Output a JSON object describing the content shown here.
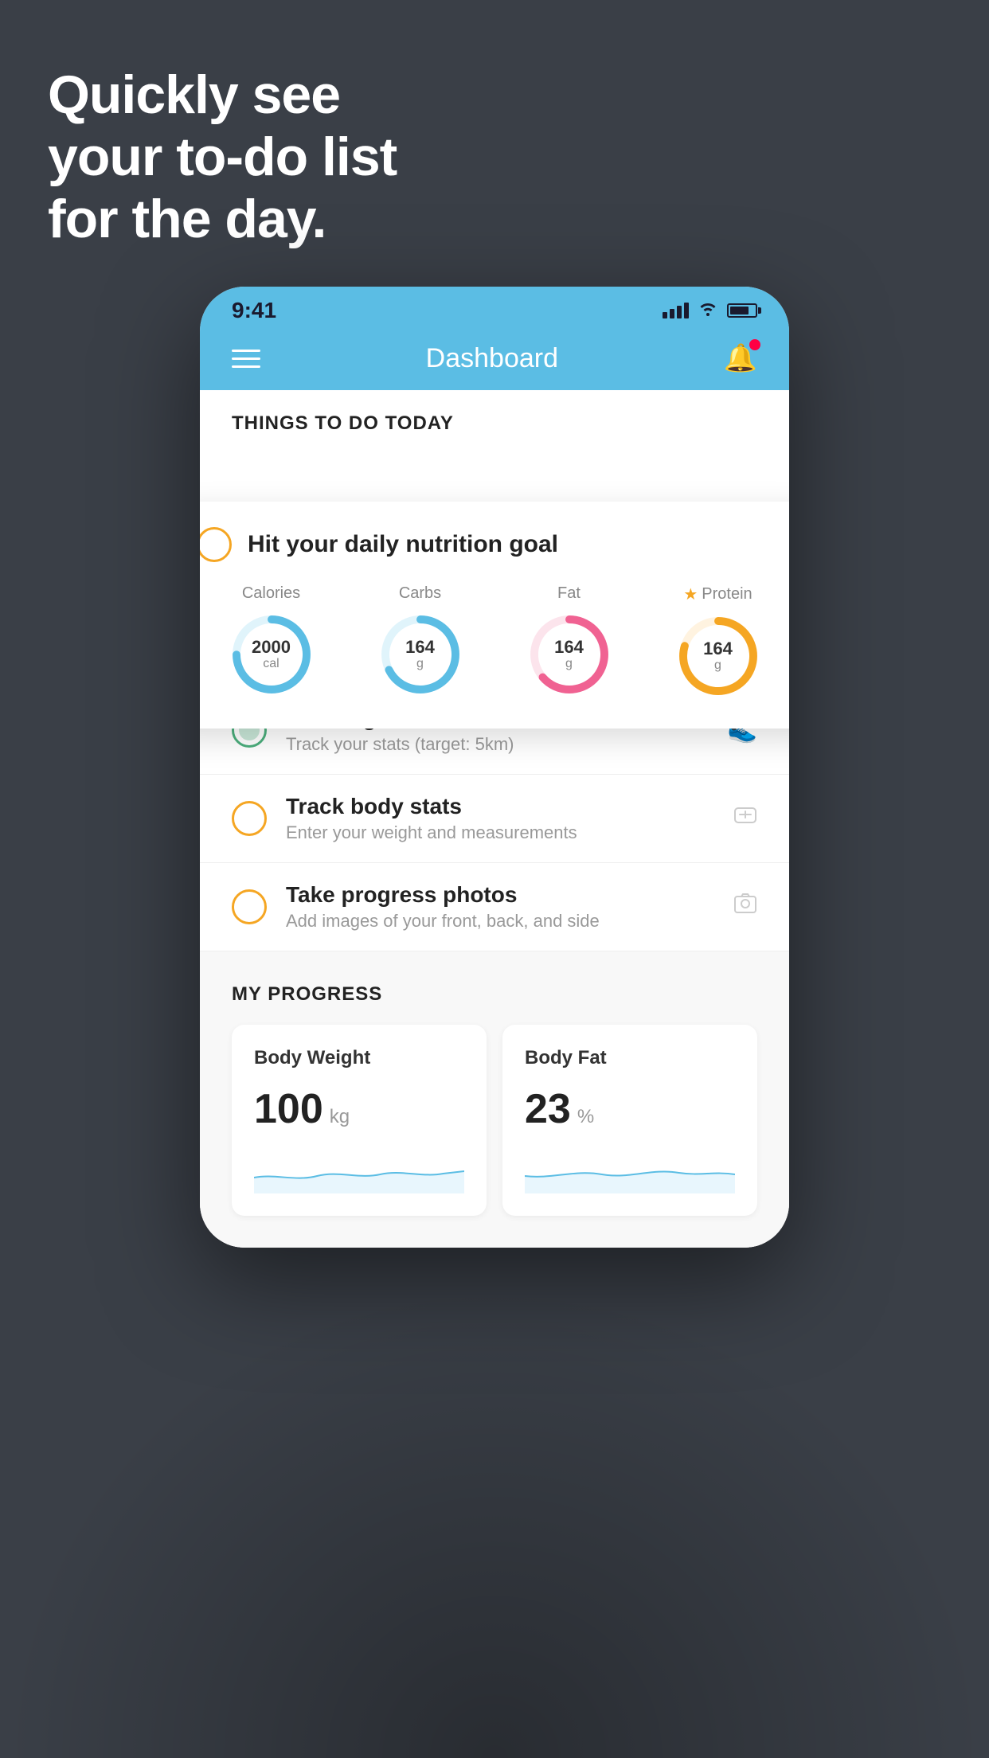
{
  "hero": {
    "line1": "Quickly see",
    "line2": "your to-do list",
    "line3": "for the day."
  },
  "status_bar": {
    "time": "9:41"
  },
  "nav": {
    "title": "Dashboard"
  },
  "section": {
    "today_title": "THINGS TO DO TODAY"
  },
  "nutrition_card": {
    "radio_label": "nutrition-radio",
    "title": "Hit your daily nutrition goal",
    "items": [
      {
        "label": "Calories",
        "value": "2000",
        "unit": "cal",
        "color": "#5bbde4",
        "track_color": "#e0f4fb"
      },
      {
        "label": "Carbs",
        "value": "164",
        "unit": "g",
        "color": "#5bbde4",
        "track_color": "#e0f4fb"
      },
      {
        "label": "Fat",
        "value": "164",
        "unit": "g",
        "color": "#f06292",
        "track_color": "#fce4ec"
      },
      {
        "label": "Protein",
        "value": "164",
        "unit": "g",
        "color": "#f5a623",
        "track_color": "#fff3e0",
        "starred": true
      }
    ]
  },
  "todo_items": [
    {
      "name": "Running",
      "desc": "Track your stats (target: 5km)",
      "circle": "green",
      "icon": "shoe"
    },
    {
      "name": "Track body stats",
      "desc": "Enter your weight and measurements",
      "circle": "yellow",
      "icon": "scale"
    },
    {
      "name": "Take progress photos",
      "desc": "Add images of your front, back, and side",
      "circle": "yellow",
      "icon": "photo"
    }
  ],
  "progress": {
    "section_title": "MY PROGRESS",
    "cards": [
      {
        "title": "Body Weight",
        "value": "100",
        "unit": "kg"
      },
      {
        "title": "Body Fat",
        "value": "23",
        "unit": "%"
      }
    ]
  }
}
